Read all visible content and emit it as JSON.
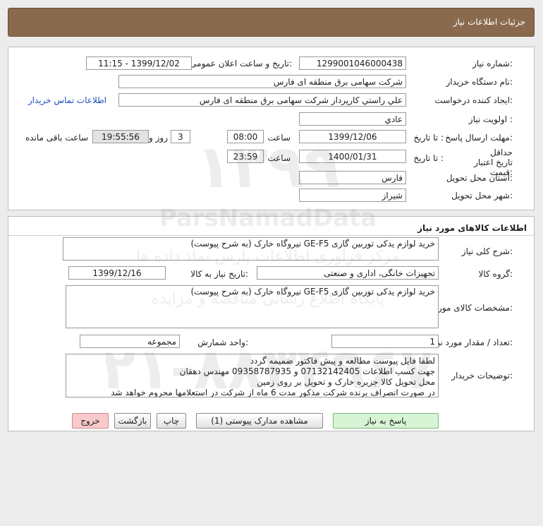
{
  "header": {
    "title": "جزئیات اطلاعات نیاز"
  },
  "info": {
    "need_number_label": "شماره نیاز:",
    "need_number": "1299001046000438",
    "announce_label": "تاریخ و ساعت اعلان عمومی:",
    "announce_value": "1399/12/02 - 11:15",
    "buyer_org_label": "نام دستگاه خریدار:",
    "buyer_org": "شرکت سهامی برق منطقه ای فارس",
    "creator_label": "ایجاد کننده درخواست:",
    "creator": "علي راستي کارپرداز شرکت سهامی برق منطقه ای فارس",
    "contact_link": "اطلاعات تماس خریدار",
    "priority_label": "اولویت نیاز :",
    "priority": "عادي",
    "deadline_label": "مهلت ارسال پاسخ:",
    "to_date_label": "تا تاریخ :",
    "deadline_date": "1399/12/06",
    "time_label": "ساعت",
    "deadline_time": "08:00",
    "days_value": "3",
    "days_label": "روز و",
    "remaining_time": "19:55:56",
    "remaining_label": "ساعت باقی مانده",
    "validity_label": "حداقل تاریخ اعتبار قیمت:",
    "validity_to_label": "تا تاریخ :",
    "validity_date": "1400/01/31",
    "validity_time_label": "ساعت",
    "validity_time": "23:59",
    "province_label": "استان محل تحویل:",
    "province": "فارس",
    "city_label": "شهر محل تحویل:",
    "city": "شیراز"
  },
  "goods": {
    "section_title": "اطلاعات کالاهای مورد نیاز",
    "general_desc_label": "شرح کلی نیاز:",
    "general_desc": "خرید لوازم یدکی توربین گازی GE-F5 نیروگاه خارک (به شرح پیوست)",
    "group_label": "گروه کالا:",
    "group": "تجهیزات خانگی، اداری و صنعتی",
    "need_date_label": "تاریخ نیاز به کالا:",
    "need_date": "1399/12/16",
    "spec_label": "مشخصات کالای مورد نیاز:",
    "spec": "خرید لوازم یدکی توربین گازی GE-F5 نیروگاه خارک (به شرح پیوست)",
    "qty_label": "تعداد / مقدار مورد نیاز:",
    "qty": "1",
    "unit_label": "واحد شمارش:",
    "unit": "مجموعه",
    "notes_label": "توضیحات خریدار:",
    "notes": [
      "لطفا فایل پیوست مطالعه و پیش فاکتور ضمیمه گردد",
      "جهت کسب اطلاعات 07132142405 و 09358787935 مهندس دهقان",
      "محل تحویل کالا جزیره خارک و تحویل بر روی زمین",
      "در صورت انصراف برنده شرکت مذکور مدت 6 ماه از شرکت در استعلامها محروم خواهد شد"
    ]
  },
  "buttons": {
    "reply": "پاسخ به نیاز",
    "view_docs": "مشاهده مدارک پیوستی (1)",
    "print": "چاپ",
    "back": "بازگشت",
    "exit": "خروج"
  },
  "watermark": {
    "text1": "ParsNamadData",
    "text2": "مرکز فراوری اطلاعات پارس نماد داده ها",
    "text3": "پایگاه اطلاع رسانی مناقصه و مزایده"
  },
  "colors": {
    "title_bar": "#8a6a4e",
    "reply_button": "#d7f5d4",
    "exit_button": "#f9c9cc",
    "link": "#1f4fbf"
  }
}
